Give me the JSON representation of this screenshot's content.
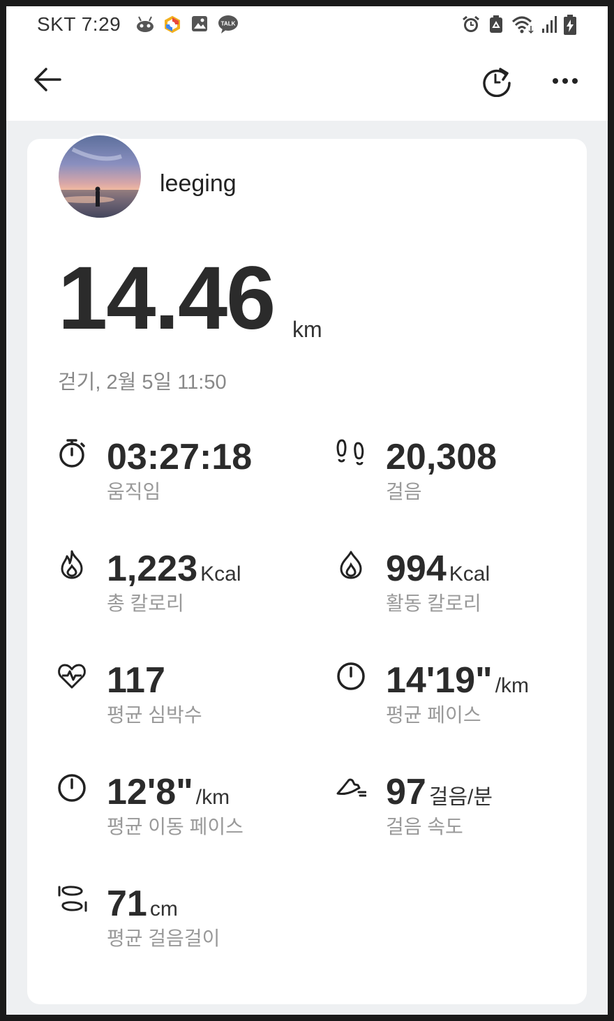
{
  "status_bar": {
    "carrier": "SKT",
    "time": "7:29",
    "left_icons": [
      "robot-icon",
      "color-ring-icon",
      "gallery-icon",
      "kakaotalk-icon"
    ],
    "talk_label": "TALK",
    "right_icons": [
      "alarm-icon",
      "recycle-icon",
      "wifi-icon",
      "signal-icon",
      "battery-charging-icon"
    ]
  },
  "header": {
    "back_icon": "arrow-left-icon",
    "share_icon": "share-rotate-icon",
    "more_icon": "more-dots-icon"
  },
  "profile": {
    "username": "leeging"
  },
  "summary": {
    "distance": "14.46",
    "distance_unit": "km",
    "subtitle": "걷기, 2월 5일 11:50"
  },
  "stats": [
    {
      "icon": "stopwatch-icon",
      "value": "03:27:18",
      "unit": "",
      "label": "움직임"
    },
    {
      "icon": "footprints-icon",
      "value": "20,308",
      "unit": "",
      "label": "걸음"
    },
    {
      "icon": "flame-icon",
      "value": "1,223",
      "unit": "Kcal",
      "label": "총 칼로리"
    },
    {
      "icon": "drop-flame-icon",
      "value": "994",
      "unit": "Kcal",
      "label": "활동 칼로리"
    },
    {
      "icon": "heart-rate-icon",
      "value": "117",
      "unit": "",
      "label": "평균 심박수"
    },
    {
      "icon": "speedometer-icon",
      "value": "14'19\"",
      "unit": "/km",
      "label": "평균 페이스"
    },
    {
      "icon": "speedometer-icon",
      "value": "12'8\"",
      "unit": "/km",
      "label": "평균 이동 페이스"
    },
    {
      "icon": "running-shoe-icon",
      "value": "97",
      "unit": "걸음/분",
      "label": "걸음 속도"
    },
    {
      "icon": "stride-icon",
      "value": "71",
      "unit": "cm",
      "label": "평균 걸음걸이"
    }
  ]
}
